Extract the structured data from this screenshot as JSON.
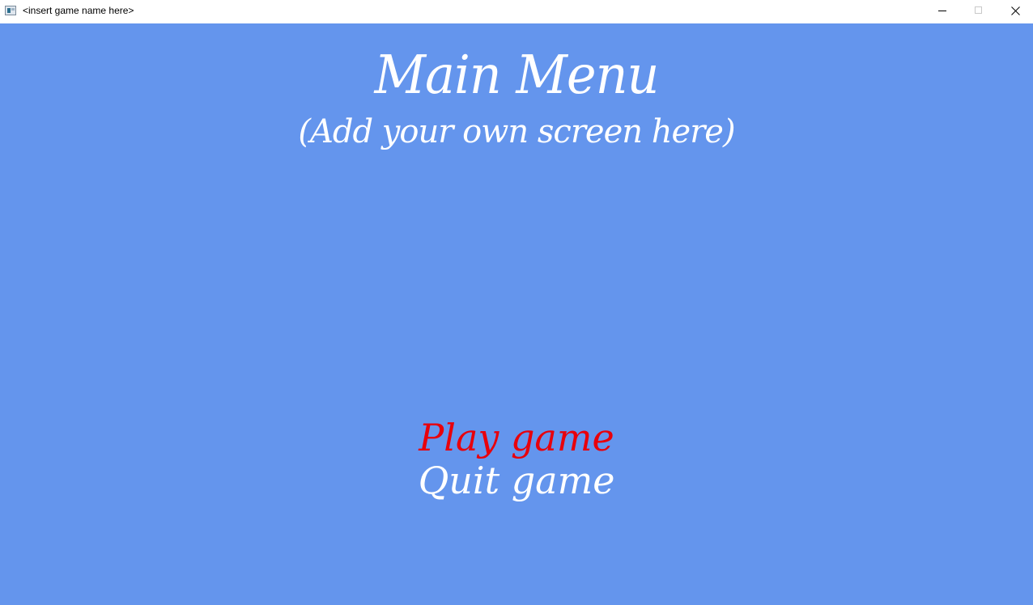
{
  "window": {
    "title": "<insert game name here>",
    "controls": [
      "minimize",
      "maximize",
      "close"
    ]
  },
  "screen": {
    "background_color": "#6495ed",
    "title": "Main Menu",
    "subtitle": "(Add your own screen here)"
  },
  "menu": {
    "items": [
      {
        "label": "Play game",
        "color": "#e8000b",
        "selected": true
      },
      {
        "label": "Quit game",
        "color": "#ffffff",
        "selected": false
      }
    ]
  }
}
